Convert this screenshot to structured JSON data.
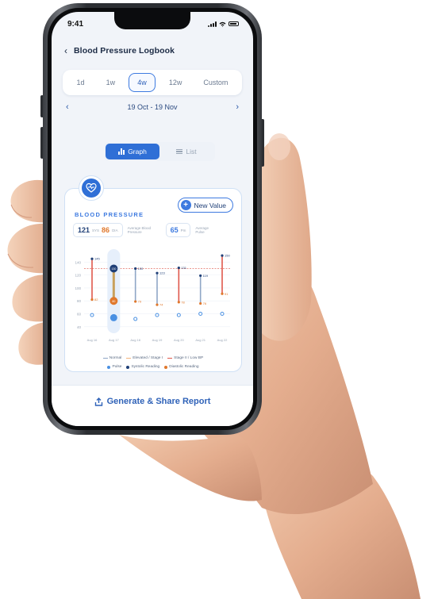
{
  "status_bar": {
    "time": "9:41"
  },
  "nav": {
    "back_icon": "chevron-left-icon",
    "title": "Blood Pressure Logbook"
  },
  "range_tabs": [
    "1d",
    "1w",
    "4w",
    "12w",
    "Custom"
  ],
  "range_tabs_active": "4w",
  "date_range": {
    "label": "19 Oct - 19 Nov"
  },
  "view_toggle": {
    "graph": "Graph",
    "list": "List",
    "active": "Graph"
  },
  "card": {
    "title": "BLOOD PRESSURE",
    "new_value": "New Value",
    "sys": "121",
    "sys_unit": "SYS",
    "dia": "86",
    "dia_unit": "DIA",
    "avg_bp_caption": "Average Blood Pressure",
    "pulse": "65",
    "pulse_unit": "Pm",
    "avg_pulse_caption": "Average Pulse"
  },
  "colors": {
    "accent": "#2f6fd6",
    "systolic": "#1f3f77",
    "diastolic": "#e0782c",
    "stage2": "#e0584c",
    "elevated": "#f2b27a",
    "normal": "#8fa6c6",
    "pulse": "#4a90e2"
  },
  "legend": {
    "line1": [
      "Normal",
      "Elevated / Stage I",
      "Stage II / Low BP"
    ],
    "line2": [
      "Pulse",
      "Systolic Reading",
      "Diastolic Reading"
    ]
  },
  "chart_data": {
    "type": "scatter",
    "y_ticks": [
      140,
      120,
      100,
      80,
      60,
      40
    ],
    "ylim": [
      30,
      160
    ],
    "categories": [
      "Aug 16",
      "Aug 17",
      "Aug 18",
      "Aug 19",
      "Aug 20",
      "Aug 21",
      "Aug 22"
    ],
    "threshold": 130,
    "systolic": [
      145,
      130,
      130,
      123,
      131,
      119,
      150
    ],
    "diastolic": [
      82,
      80,
      79,
      74,
      78,
      76,
      91
    ],
    "pulse": [
      58,
      54,
      52,
      58,
      58,
      60,
      60
    ],
    "labels_sys": [
      "145",
      "130",
      "130",
      "123",
      "131",
      "119",
      "150"
    ],
    "labels_dia": [
      "82",
      "80",
      "79",
      "74",
      "78",
      "76",
      "91"
    ],
    "categories_of_reading": [
      "stage2",
      "selected",
      "normal",
      "normal",
      "stage2",
      "normal",
      "stage2"
    ],
    "selected_index": 1
  },
  "footer": {
    "share_icon": "share-icon",
    "report_label": "Generate & Share Report"
  }
}
